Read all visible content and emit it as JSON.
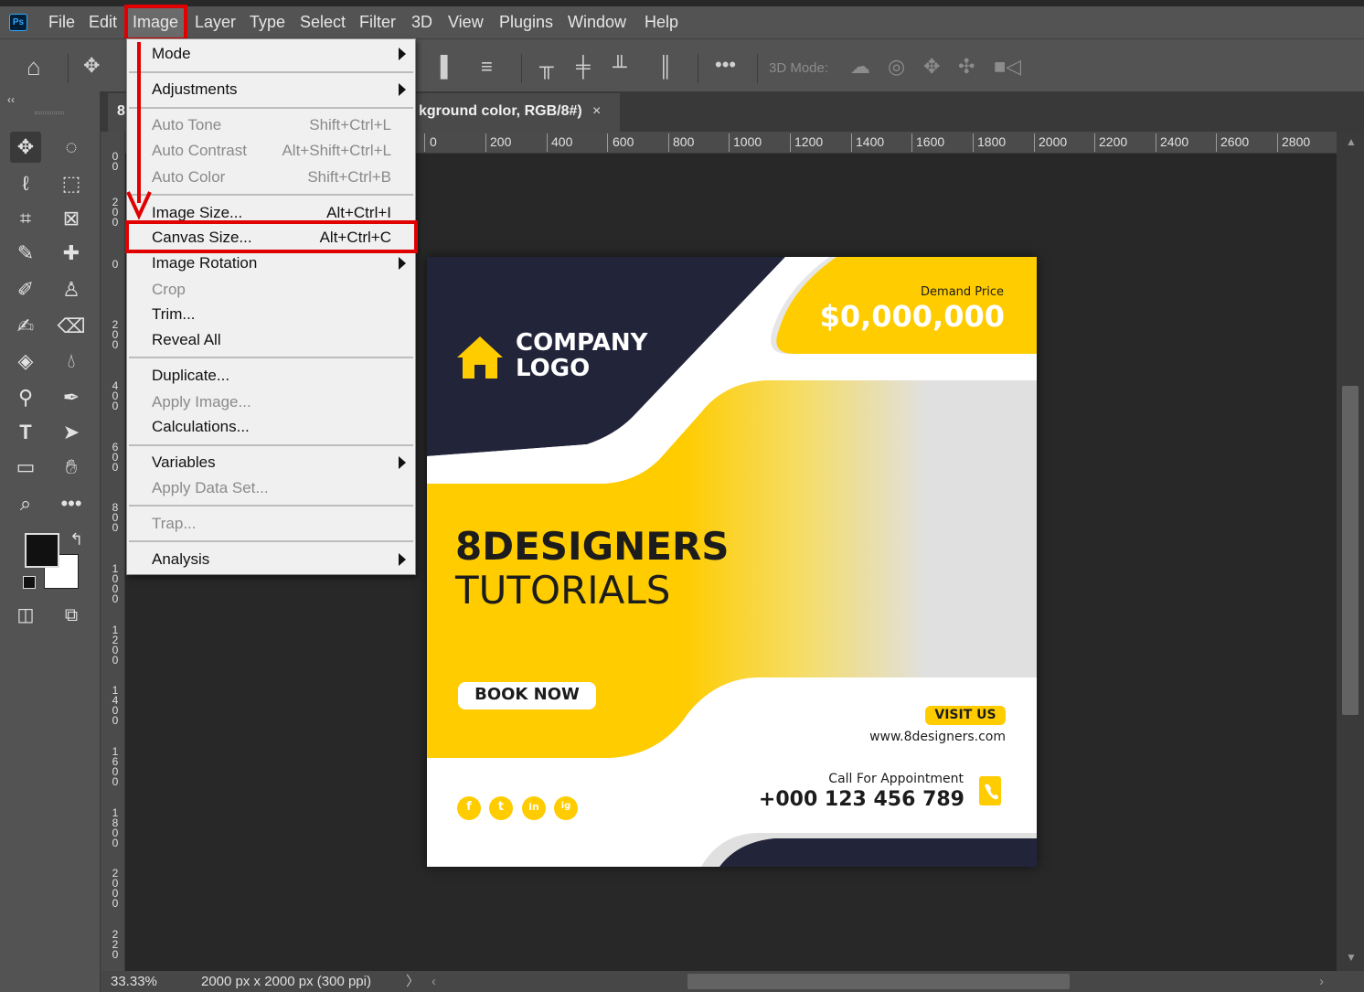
{
  "app": {
    "logo": "Ps"
  },
  "menubar": {
    "items": [
      "File",
      "Edit",
      "Image",
      "Layer",
      "Type",
      "Select",
      "Filter",
      "3D",
      "View",
      "Plugins",
      "Window",
      "Help"
    ]
  },
  "options": {
    "mode_3d": "3D Mode:"
  },
  "document": {
    "tab_prefix": "8",
    "tab_title": "kground color, RGB/8#)",
    "close": "×",
    "zoom": "33.33%",
    "size_info": "2000 px x 2000 px (300 ppi)"
  },
  "ruler": {
    "top": [
      "0",
      "200",
      "400",
      "600",
      "800",
      "1000",
      "1200",
      "1400",
      "1600",
      "1800",
      "2000",
      "2200",
      "2400",
      "2600",
      "2800"
    ],
    "left": [
      "0\n0",
      "2\n0\n0",
      "0",
      "2\n0\n0",
      "4\n0\n0",
      "6\n0\n0",
      "8\n0\n0",
      "1\n0\n0\n0",
      "1\n2\n0\n0",
      "1\n4\n0\n0",
      "1\n6\n0\n0",
      "1\n8\n0\n0",
      "2\n0\n0\n0",
      "2\n2\n0"
    ]
  },
  "image_menu": {
    "mode": "Mode",
    "adjustments": "Adjustments",
    "auto_tone": "Auto Tone",
    "auto_tone_sc": "Shift+Ctrl+L",
    "auto_contrast": "Auto Contrast",
    "auto_contrast_sc": "Alt+Shift+Ctrl+L",
    "auto_color": "Auto Color",
    "auto_color_sc": "Shift+Ctrl+B",
    "image_size": "Image Size...",
    "image_size_sc": "Alt+Ctrl+I",
    "canvas_size": "Canvas Size...",
    "canvas_size_sc": "Alt+Ctrl+C",
    "image_rotation": "Image Rotation",
    "crop": "Crop",
    "trim": "Trim...",
    "reveal_all": "Reveal All",
    "duplicate": "Duplicate...",
    "apply_image": "Apply Image...",
    "calculations": "Calculations...",
    "variables": "Variables",
    "apply_data_set": "Apply Data Set...",
    "trap": "Trap...",
    "analysis": "Analysis"
  },
  "artwork": {
    "demand_label": "Demand Price",
    "price": "$0,000,000",
    "logo_line1": "COMPANY",
    "logo_line2": "LOGO",
    "headline1": "8DESIGNERS",
    "headline2": "TUTORIALS",
    "book_now": "BOOK NOW",
    "visit_us": "VISIT US",
    "website": "www.8designers.com",
    "call_label": "Call For Appointment",
    "phone": "+000 123 456 789",
    "social": [
      "f",
      "t",
      "in",
      "ig"
    ]
  },
  "colors": {
    "accent_yellow": "#ffcc00",
    "navy": "#22243a",
    "highlight_red": "#e00000"
  }
}
